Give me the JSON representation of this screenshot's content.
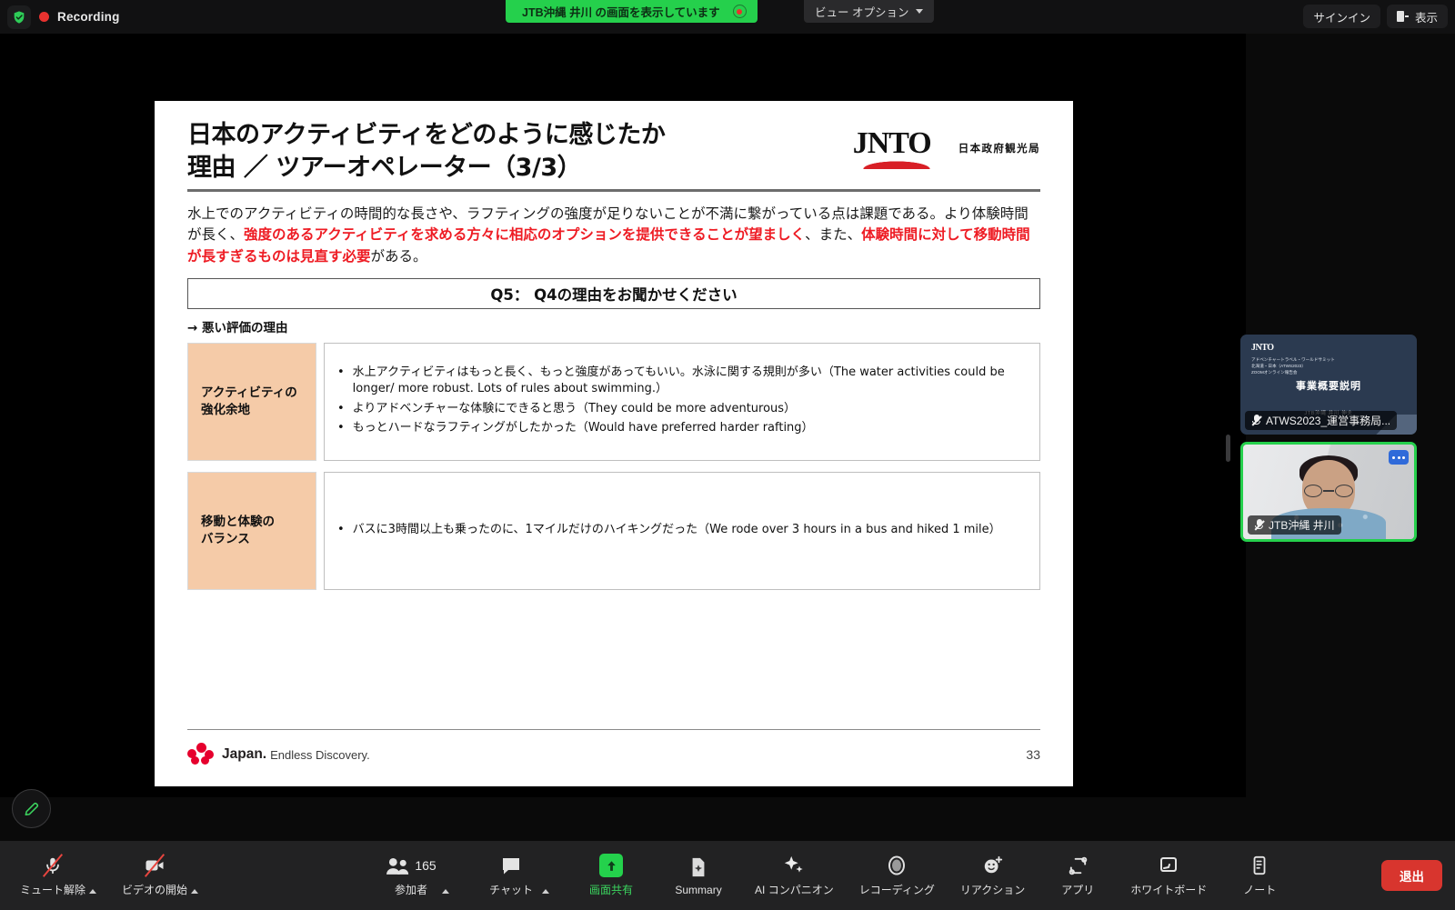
{
  "topbar": {
    "recording_label": "Recording",
    "shield_icon": "shield-check-icon",
    "share_banner_text": "JTB沖縄 井川 の画面を表示しています",
    "stop_share_icon": "stop-share-icon",
    "view_options_label": "ビュー オプション",
    "sign_in_label": "サインイン",
    "display_label": "表示"
  },
  "slide": {
    "title": "日本のアクティビティをどのように感じたか\n理由 ／ ツアーオペレーター（3/3）",
    "logo_text": "JNTO",
    "logo_subtitle": "日本政府観光局",
    "lead_part1": "水上でのアクティビティの時間的な長さや、ラフティングの強度が足りないことが不満に繋がっている点は課題である。より体験時間が長く、",
    "lead_hl1": "強度のあるアクティビティを求める方々に相応のオプションを提供できることが望ましく",
    "lead_part2": "、また、",
    "lead_hl2": "体験時間に対して移動時間が長すぎるものは見直す必要",
    "lead_part3": "がある。",
    "question_bar": "Q5： Q4の理由をお聞かせください",
    "subheading": "→ 悪い評価の理由",
    "rows": [
      {
        "key": "アクティビティの\n強化余地",
        "bullets": [
          "水上アクティビティはもっと長く、もっと強度があってもいい。水泳に関する規則が多い（The water activities could be longer/ more robust. Lots of rules about swimming.）",
          "よりアドベンチャーな体験にできると思う（They could be more adventurous）",
          "もっとハードなラフティングがしたかった（Would have preferred harder rafting）"
        ]
      },
      {
        "key": "移動と体験の\nバランス",
        "bullets": [
          "バスに3時間以上も乗ったのに、1マイルだけのハイキングだった（We rode over 3 hours in a bus and hiked 1 mile）"
        ]
      }
    ],
    "footer_brand": "Japan.",
    "footer_tagline": "Endless Discovery.",
    "page_number": "33",
    "accent_peach": "#f5cba8",
    "accent_red": "#ee1c24"
  },
  "filmstrip": {
    "tiles": [
      {
        "name": "ATWS2023_運営事務局...",
        "mic_icon": "mic-off-icon",
        "active": false,
        "preview_logo": "JNTO",
        "preview_sub": "アドベンチャートラベル・ワールドサミット\n北海道・日本（ATWS2023）\nZOOMオンライン報告会",
        "preview_title": "事業概要説明",
        "preview_presenter": "JTB沖縄 井川 伸夫"
      },
      {
        "name": "JTB沖縄 井川",
        "mic_icon": "mic-off-icon",
        "active": true,
        "more_icon": "more-options-icon"
      }
    ]
  },
  "annotation": {
    "icon": "pencil-icon",
    "color": "#3bd45e"
  },
  "toolbar": {
    "items": [
      {
        "label": "ミュート解除",
        "icon": "mic-off-icon",
        "caret": true,
        "highlight": false
      },
      {
        "label": "ビデオの開始",
        "icon": "video-off-icon",
        "caret": true,
        "highlight": false
      },
      {
        "label": "参加者",
        "icon": "participants-icon",
        "count": "165",
        "caret": true,
        "highlight": false
      },
      {
        "label": "チャット",
        "icon": "chat-icon",
        "caret": true,
        "highlight": false
      },
      {
        "label": "画面共有",
        "icon": "share-screen-icon",
        "caret": false,
        "highlight": true
      },
      {
        "label": "Summary",
        "icon": "summary-icon",
        "caret": false,
        "highlight": false
      },
      {
        "label": "AI コンパニオン",
        "icon": "ai-companion-icon",
        "caret": false,
        "highlight": false
      },
      {
        "label": "レコーディング",
        "icon": "record-icon",
        "caret": false,
        "highlight": false
      },
      {
        "label": "リアクション",
        "icon": "reactions-icon",
        "caret": false,
        "highlight": false
      },
      {
        "label": "アプリ",
        "icon": "apps-icon",
        "caret": false,
        "highlight": false
      },
      {
        "label": "ホワイトボード",
        "icon": "whiteboard-icon",
        "caret": false,
        "highlight": false
      },
      {
        "label": "ノート",
        "icon": "notes-icon",
        "caret": false,
        "highlight": false
      }
    ],
    "leave_label": "退出",
    "leave_color": "#d8352e"
  }
}
